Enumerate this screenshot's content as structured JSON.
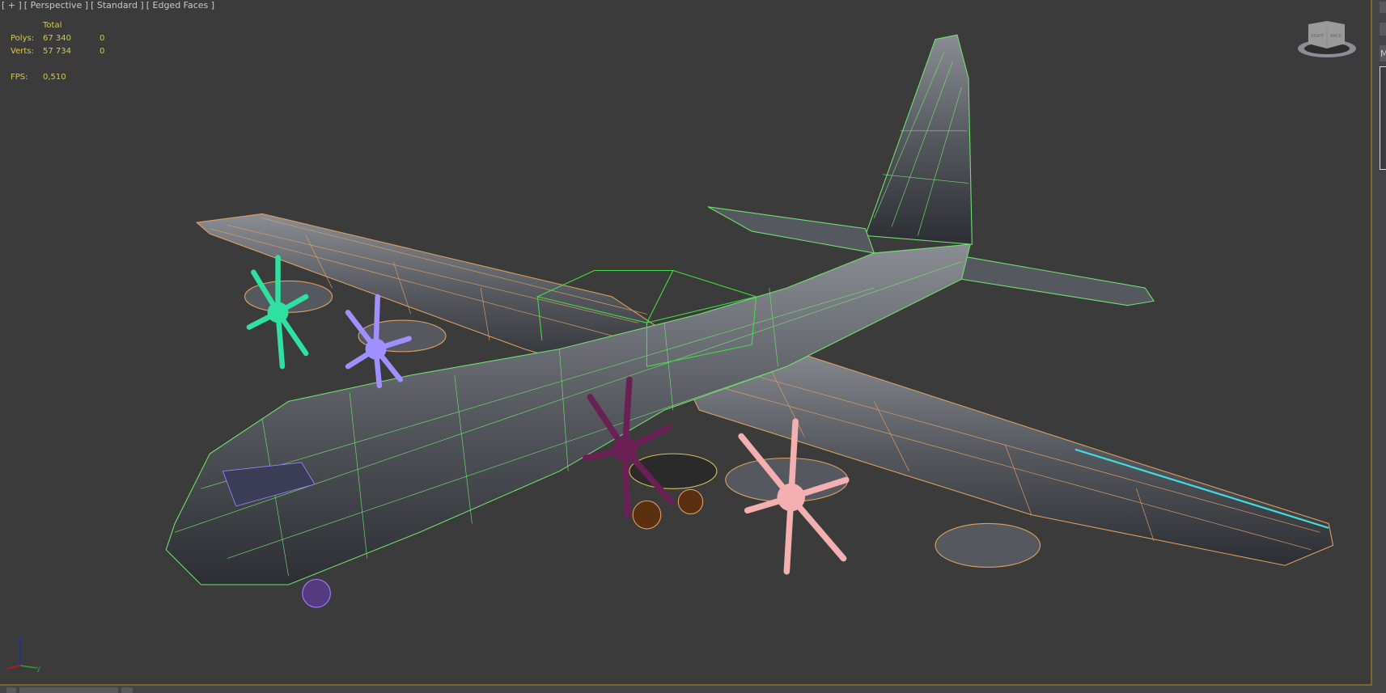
{
  "viewport": {
    "labels": [
      "[ + ]",
      "[ Perspective ]",
      "[ Standard ]",
      "[ Edged Faces ]"
    ],
    "stats": {
      "header": "Total",
      "rows": [
        {
          "label": "Polys:",
          "total": "67 340",
          "selected": "0"
        },
        {
          "label": "Verts:",
          "total": "57 734",
          "selected": "0"
        }
      ],
      "fps_label": "FPS:",
      "fps_value": "0,510"
    },
    "viewcube": {
      "left_face": "RIGHT",
      "right_face": "BACK"
    },
    "axis": {
      "x": "x",
      "y": "y",
      "z": "z"
    }
  },
  "command_panel": {
    "tab_initial": "M"
  },
  "colors": {
    "background": "#3b3b3b",
    "stats_text": "#d6c84a",
    "wire_orange": "#e0a060",
    "wire_green": "#70e070",
    "viewport_border": "#7a6535"
  }
}
